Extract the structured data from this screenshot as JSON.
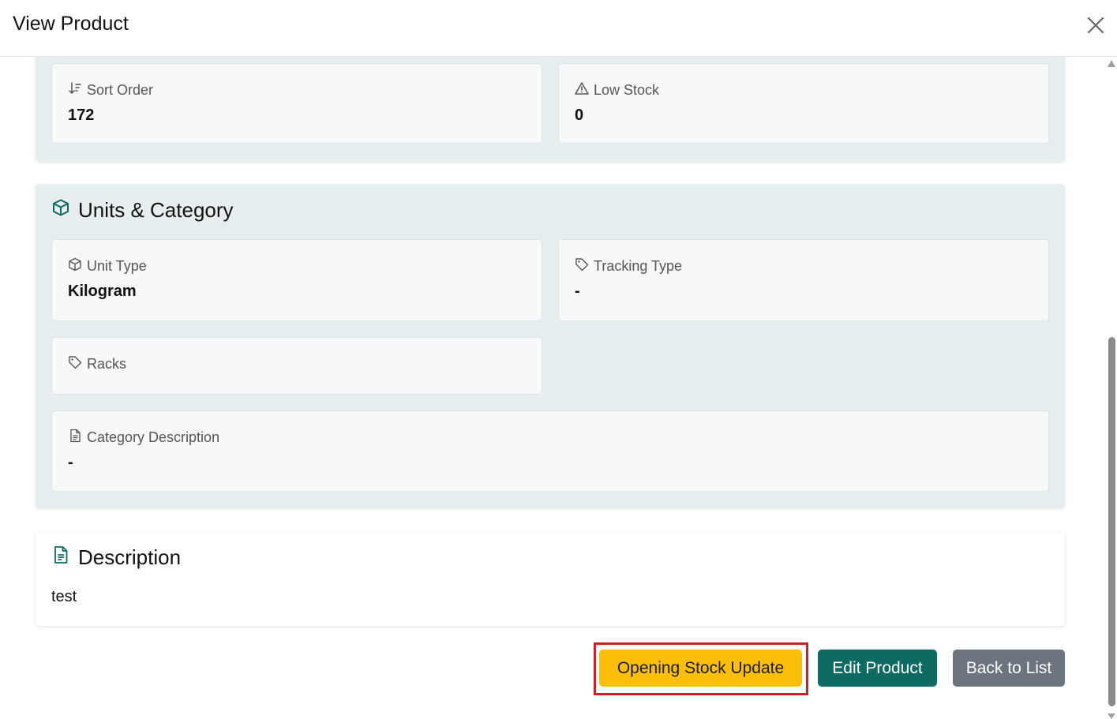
{
  "modal": {
    "title": "View Product",
    "close_icon": "close-icon"
  },
  "stock_panel": {
    "sort_order": {
      "label": "Sort Order",
      "value": "172",
      "icon": "sort-icon"
    },
    "low_stock": {
      "label": "Low Stock",
      "value": "0",
      "icon": "warning-icon"
    }
  },
  "units_category": {
    "title": "Units & Category",
    "icon": "box-icon",
    "unit_type": {
      "label": "Unit Type",
      "value": "Kilogram",
      "icon": "box-icon"
    },
    "tracking_type": {
      "label": "Tracking Type",
      "value": "-",
      "icon": "tag-icon"
    },
    "racks": {
      "label": "Racks",
      "value": "",
      "icon": "tag-icon"
    },
    "category_description": {
      "label": "Category Description",
      "value": "-",
      "icon": "document-icon"
    }
  },
  "description": {
    "title": "Description",
    "icon": "document-icon",
    "text": "test"
  },
  "actions": {
    "opening_stock_label": "Opening Stock Update",
    "edit_label": "Edit Product",
    "back_label": "Back to List"
  },
  "colors": {
    "accent": "#0e6b63",
    "warning": "#fbbf09",
    "secondary": "#6c757d",
    "highlight": "#d6192b"
  }
}
